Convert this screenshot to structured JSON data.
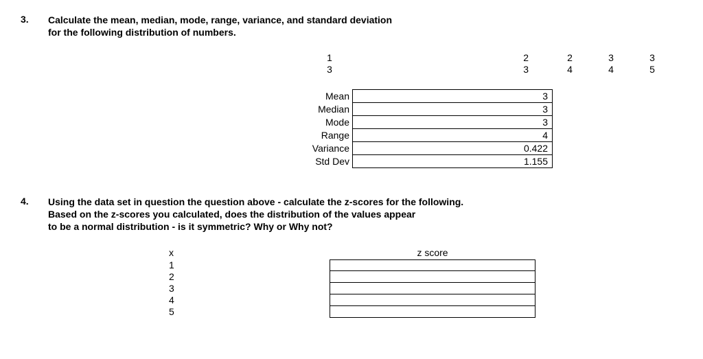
{
  "q3": {
    "number": "3.",
    "text_line1": "Calculate the mean, median, mode, range, variance, and standard deviation",
    "text_line2": "for the following distribution of numbers.",
    "data_row1": [
      "1",
      "2",
      "2",
      "3",
      "3"
    ],
    "data_row2": [
      "3",
      "3",
      "4",
      "4",
      "5"
    ],
    "stats": [
      {
        "label": "Mean",
        "value": "3"
      },
      {
        "label": "Median",
        "value": "3"
      },
      {
        "label": "Mode",
        "value": "3"
      },
      {
        "label": "Range",
        "value": "4"
      },
      {
        "label": "Variance",
        "value": "0.422"
      },
      {
        "label": "Std Dev",
        "value": "1.155"
      }
    ]
  },
  "q4": {
    "number": "4.",
    "text_line1": "Using the data set in question the question above - calculate the z-scores for the following.",
    "text_line2": "Based on the z-scores you calculated, does the distribution of the values appear",
    "text_line3": "to be a normal distribution - is it symmetric?  Why or Why not?",
    "x_header": "x",
    "z_header": "z score",
    "x_values": [
      "1",
      "2",
      "3",
      "4",
      "5"
    ]
  },
  "chart_data": {
    "type": "table",
    "title": "Statistics worksheet",
    "dataset": [
      1,
      2,
      2,
      3,
      3,
      3,
      3,
      4,
      4,
      5
    ],
    "statistics": {
      "mean": 3,
      "median": 3,
      "mode": 3,
      "range": 4,
      "variance": 0.422,
      "std_dev": 1.155
    },
    "z_score_inputs": [
      1,
      2,
      3,
      4,
      5
    ]
  }
}
